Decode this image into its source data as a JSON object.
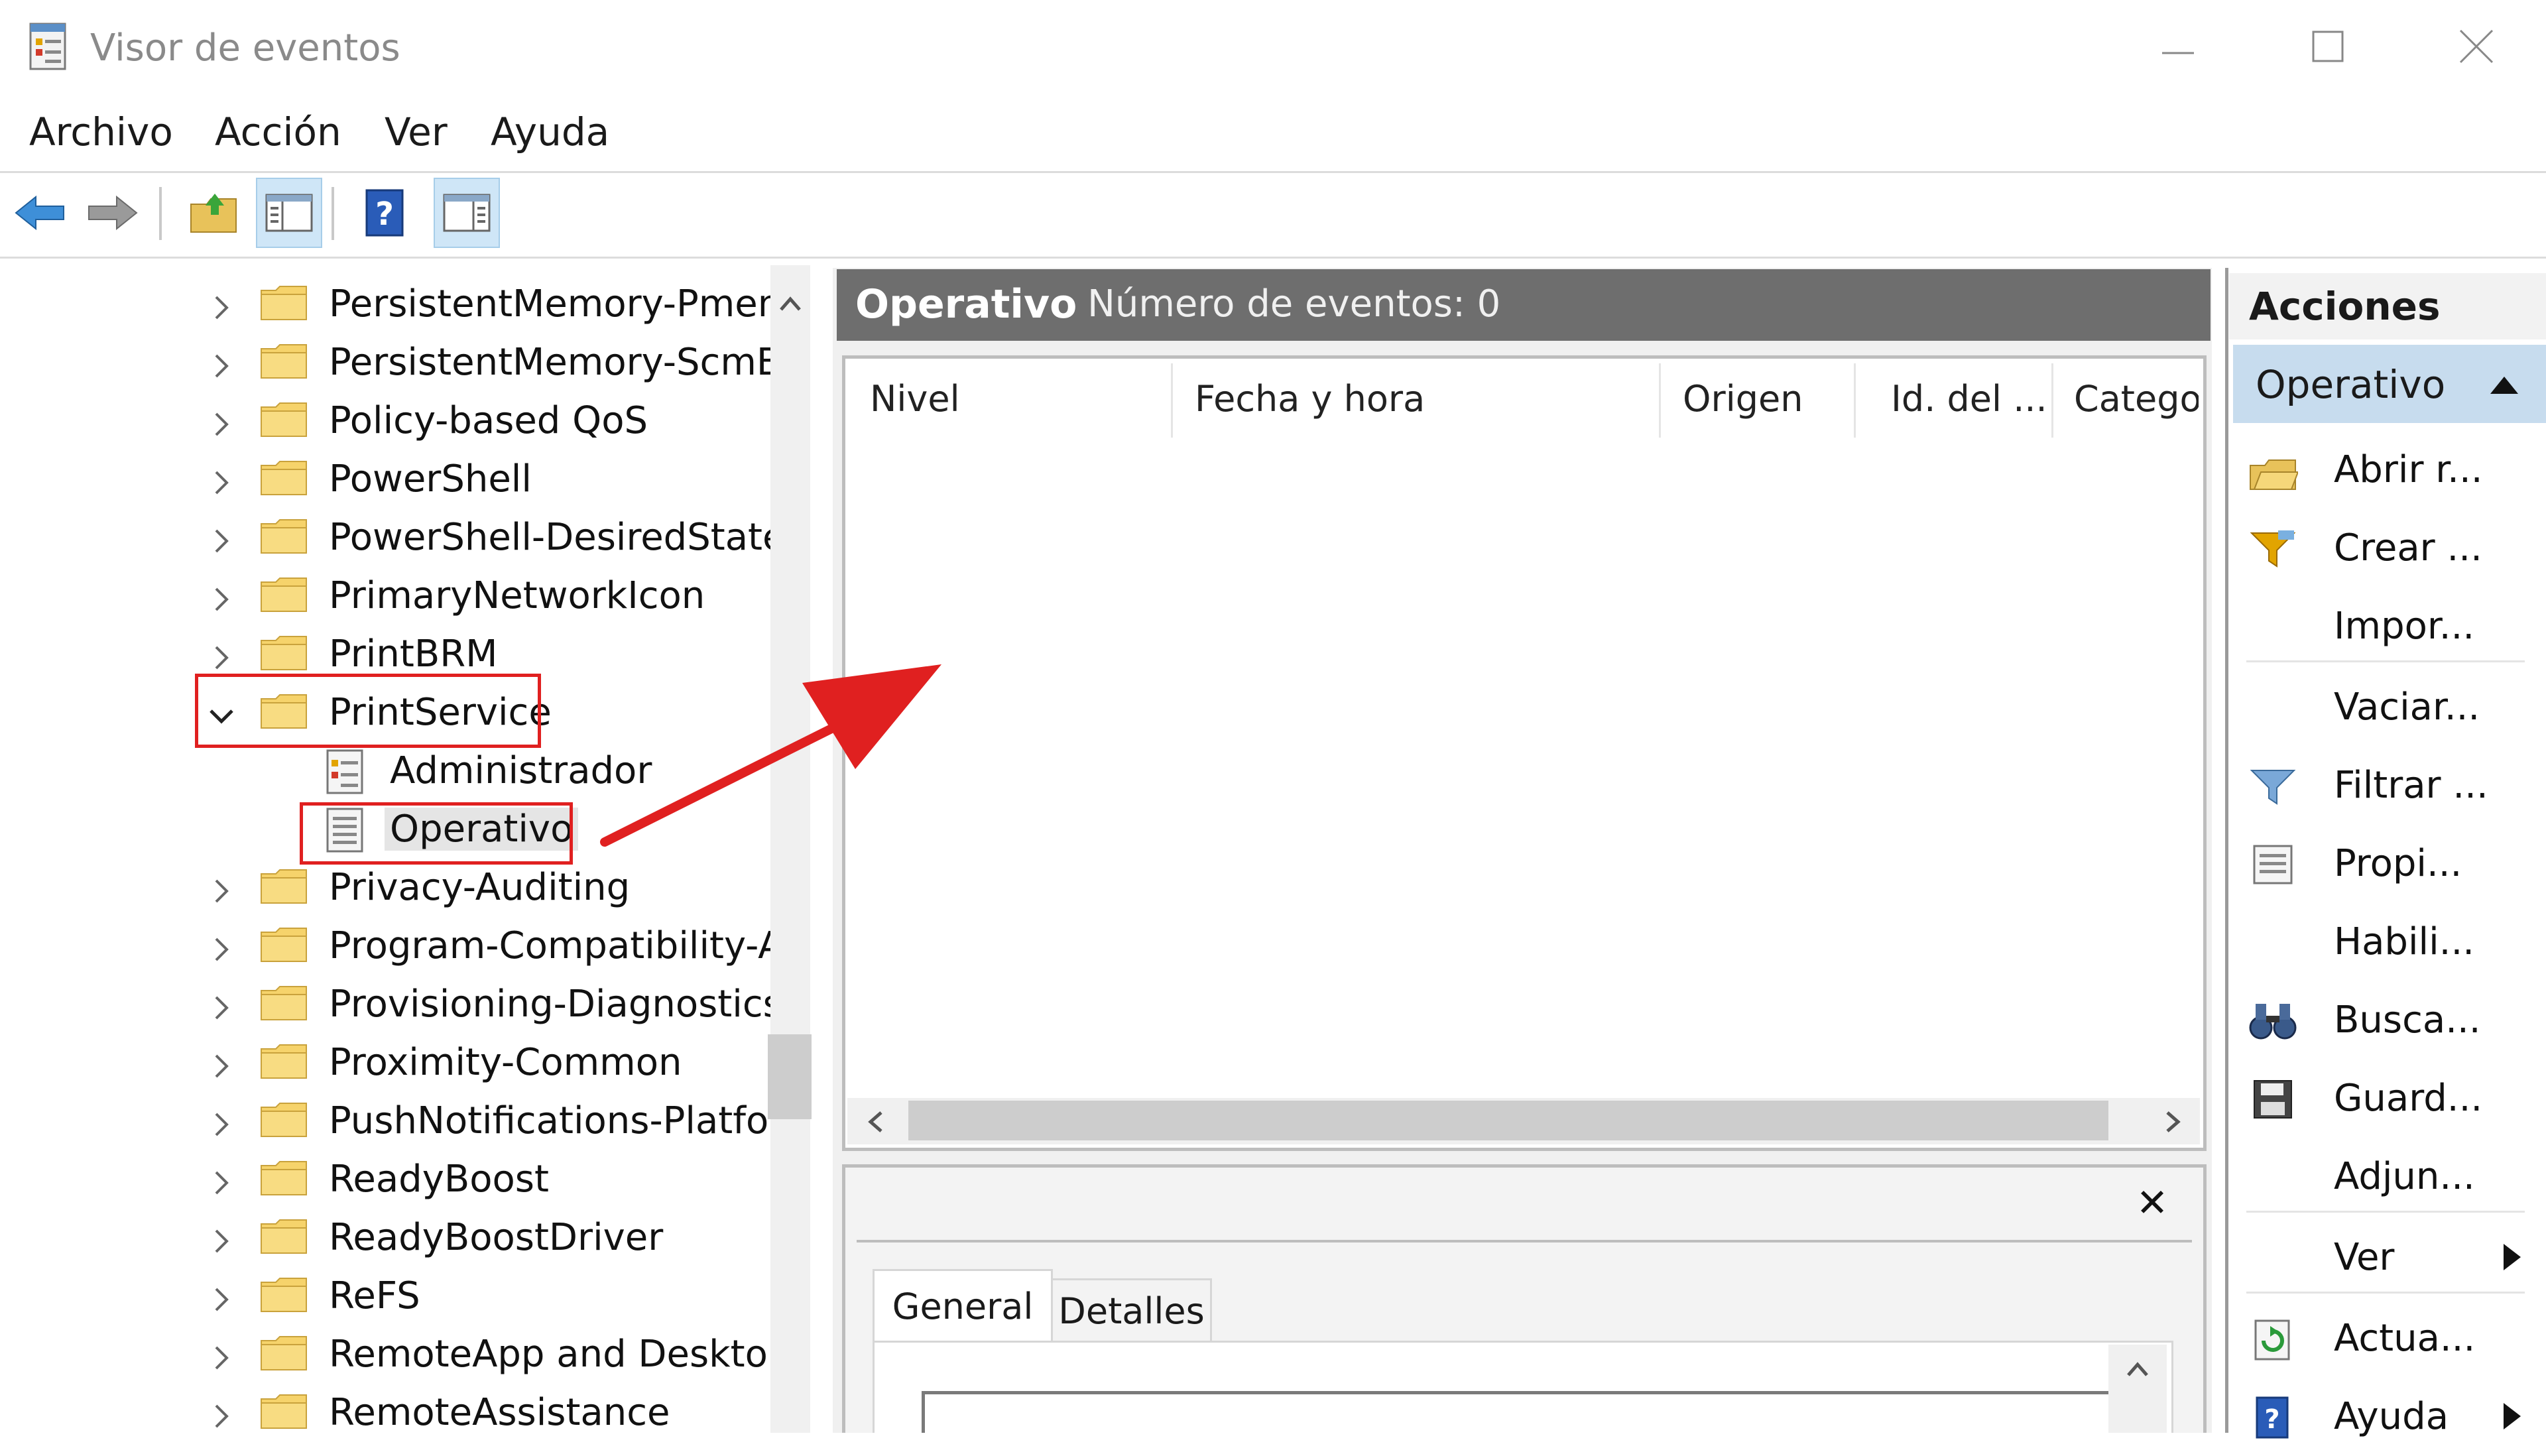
{
  "window": {
    "title": "Visor de eventos",
    "icons": {
      "app": "event-viewer-icon",
      "minimize": "minimize-icon",
      "maximize": "maximize-icon",
      "close": "close-icon"
    }
  },
  "menu": {
    "items": [
      "Archivo",
      "Acción",
      "Ver",
      "Ayuda"
    ]
  },
  "toolbar": {
    "buttons": [
      "back-arrow-icon",
      "forward-arrow-icon",
      "open-folder-icon",
      "show-hide-tree-icon",
      "help-icon",
      "show-hide-action-pane-icon"
    ]
  },
  "tree": {
    "items": [
      {
        "label": "PersistentMemory-Pmem",
        "expanded": false
      },
      {
        "label": "PersistentMemory-ScmBı",
        "expanded": false
      },
      {
        "label": "Policy-based QoS",
        "expanded": false
      },
      {
        "label": "PowerShell",
        "expanded": false
      },
      {
        "label": "PowerShell-DesiredStateC",
        "expanded": false
      },
      {
        "label": "PrimaryNetworkIcon",
        "expanded": false
      },
      {
        "label": "PrintBRM",
        "expanded": false
      },
      {
        "label": "PrintService",
        "expanded": true,
        "children": [
          {
            "label": "Administrador",
            "selected": false
          },
          {
            "label": "Operativo",
            "selected": true
          }
        ]
      },
      {
        "label": "Privacy-Auditing",
        "expanded": false
      },
      {
        "label": "Program-Compatibility-A",
        "expanded": false
      },
      {
        "label": "Provisioning-Diagnostics",
        "expanded": false
      },
      {
        "label": "Proximity-Common",
        "expanded": false
      },
      {
        "label": "PushNotifications-Platfor",
        "expanded": false
      },
      {
        "label": "ReadyBoost",
        "expanded": false
      },
      {
        "label": "ReadyBoostDriver",
        "expanded": false
      },
      {
        "label": "ReFS",
        "expanded": false
      },
      {
        "label": "RemoteApp and Desktop",
        "expanded": false
      },
      {
        "label": "RemoteAssistance",
        "expanded": false
      }
    ]
  },
  "center": {
    "title": "Operativo",
    "event_count": "Número de eventos: 0",
    "columns": [
      "Nivel",
      "Fecha y hora",
      "Origen",
      "Id. del ...",
      "Catego"
    ],
    "rows": []
  },
  "details": {
    "close_glyph": "✕",
    "tabs": [
      {
        "label": "General",
        "active": true
      },
      {
        "label": "Detalles",
        "active": false
      }
    ]
  },
  "actions": {
    "title": "Acciones",
    "section": "Operativo",
    "items": [
      {
        "label": "Abrir r...",
        "icon": "open-log-icon",
        "submenu": false
      },
      {
        "label": "Crear ...",
        "icon": "create-view-filter-icon",
        "submenu": false
      },
      {
        "label": "Impor...",
        "icon": "",
        "submenu": false
      },
      {
        "label": "Vaciar...",
        "icon": "",
        "submenu": false
      },
      {
        "label": "Filtrar ...",
        "icon": "filter-icon",
        "submenu": false
      },
      {
        "label": "Propi...",
        "icon": "properties-icon",
        "submenu": false
      },
      {
        "label": "Habili...",
        "icon": "",
        "submenu": false
      },
      {
        "label": "Busca...",
        "icon": "binoculars-icon",
        "submenu": false
      },
      {
        "label": "Guard...",
        "icon": "save-icon",
        "submenu": false
      },
      {
        "label": "Adjun...",
        "icon": "",
        "submenu": false
      },
      {
        "label": "Ver",
        "icon": "",
        "submenu": true
      },
      {
        "label": "Actua...",
        "icon": "refresh-icon",
        "submenu": false
      },
      {
        "label": "Ayuda",
        "icon": "help-icon",
        "submenu": true
      }
    ]
  },
  "annotation": {
    "color": "#e02020",
    "highlighted": [
      "PrintService",
      "Operativo"
    ]
  }
}
